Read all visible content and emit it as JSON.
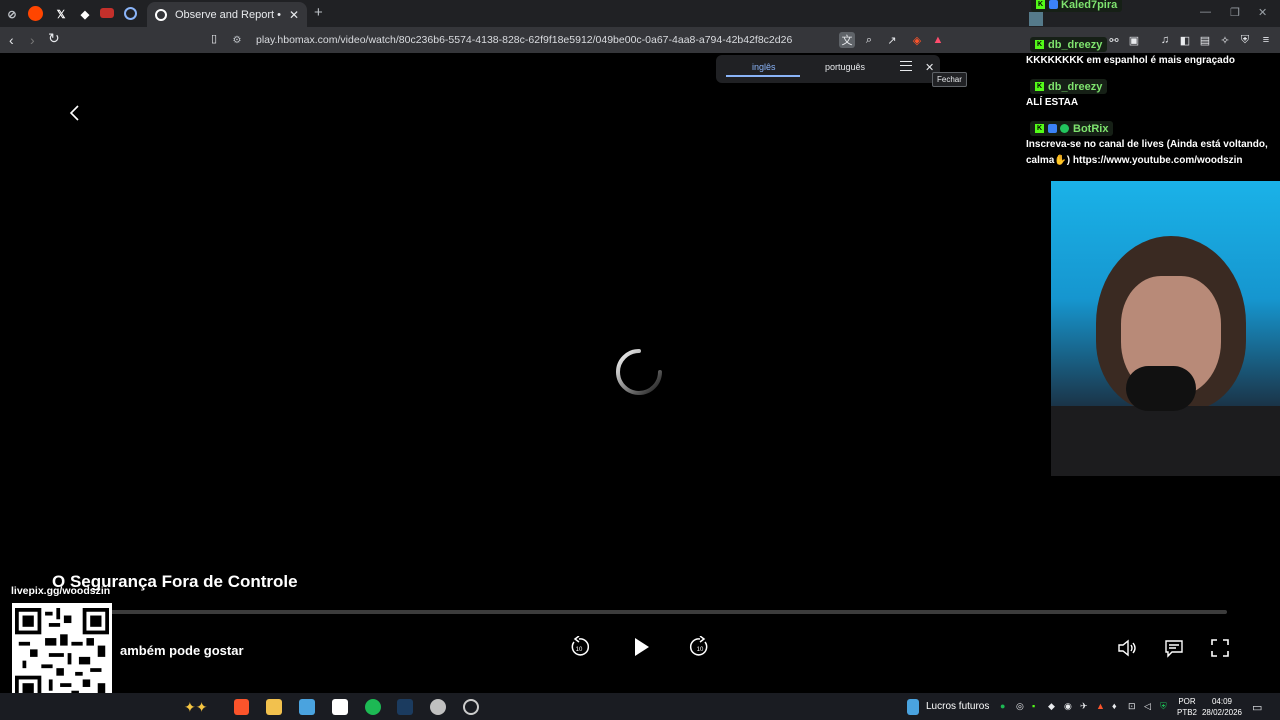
{
  "browser": {
    "active_tab_title": "Observe and Report • HBO Max",
    "url": "play.hbomax.com/video/watch/80c236b6-5574-4138-828c-62f9f18e5912/049be00c-0a67-4aa8-a794-42b42f8c2d26",
    "pinned_tab_icons": [
      "speaker-off-icon",
      "reddit-icon",
      "x-icon",
      "app-icon",
      "youtube-icon",
      "globe-icon"
    ]
  },
  "translate_popup": {
    "source_language": "inglês",
    "target_language": "português",
    "close_tooltip": "Fechar"
  },
  "player": {
    "title": "O Segurança Fora de Controle",
    "also_like": "ambém pode gostar",
    "controls": [
      "rewind-10-icon",
      "play-icon",
      "forward-10-icon",
      "volume-icon",
      "subtitles-icon",
      "fullscreen-icon"
    ],
    "skip_seconds": "10"
  },
  "chat": {
    "messages": [
      {
        "user": "Kaled7pira",
        "text": ""
      },
      {
        "user": "db_dreezy",
        "text": "KKKKKKKK em espanhol é mais engraçado"
      },
      {
        "user": "db_dreezy",
        "text": "ALÍ ESTAA"
      },
      {
        "user": "BotRix",
        "text": "Inscreva-se no canal de lives (Ainda está voltando, calma✋) https://www.youtube.com/woodszin"
      }
    ]
  },
  "overlay": {
    "livepix": "livepix.gg/woodszin"
  },
  "taskbar": {
    "widget_label": "Lucros futuros",
    "language_line1": "POR",
    "language_line2": "PTB2",
    "time": "04:09",
    "date": "28/02/2026"
  },
  "colors": {
    "accent_blue": "#8ab4f8",
    "kick_green": "#53fc18",
    "username_green": "#7ee36e"
  }
}
